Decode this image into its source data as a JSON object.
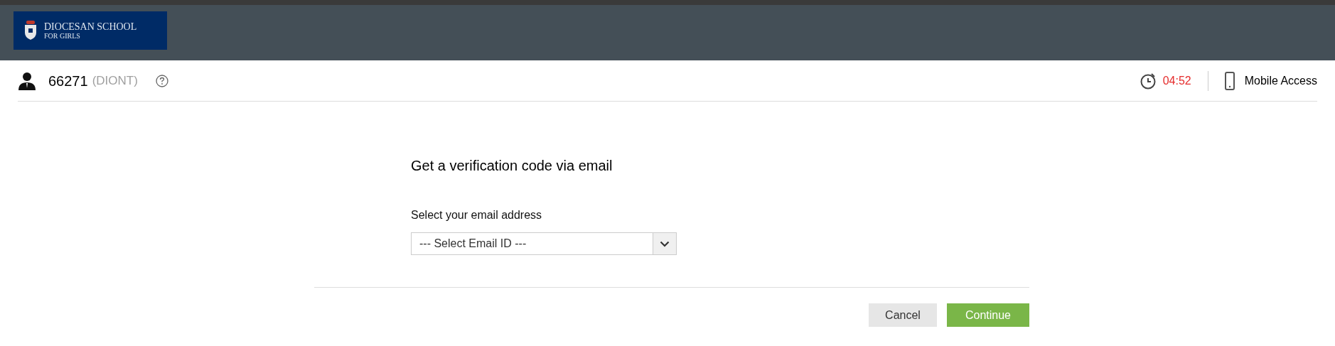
{
  "logo": {
    "name": "DIOCESAN SCHOOL",
    "subtitle": "FOR GIRLS"
  },
  "user": {
    "id": "66271",
    "code": "(DIONT)"
  },
  "timer": "04:52",
  "mobile_access": "Mobile Access",
  "form": {
    "title": "Get a verification code via email",
    "label": "Select your email address",
    "select": {
      "value": "--- Select Email ID ---"
    }
  },
  "buttons": [
    {
      "label": "Cancel",
      "kind": "secondary"
    },
    {
      "label": "Continue",
      "kind": "primary"
    }
  ]
}
